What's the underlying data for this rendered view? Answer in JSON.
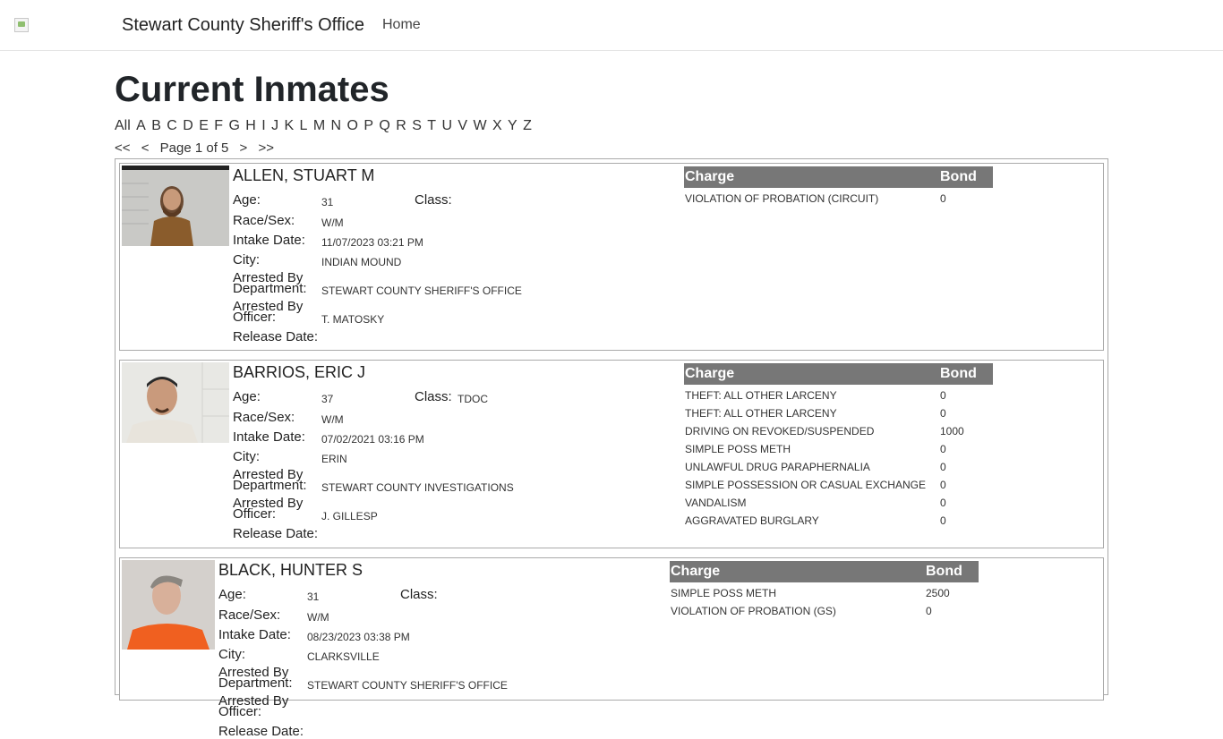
{
  "nav": {
    "brand": "Stewart County Sheriff's Office",
    "home": "Home"
  },
  "page_title": "Current Inmates",
  "letters": [
    "All",
    "A",
    "B",
    "C",
    "D",
    "E",
    "F",
    "G",
    "H",
    "I",
    "J",
    "K",
    "L",
    "M",
    "N",
    "O",
    "P",
    "Q",
    "R",
    "S",
    "T",
    "U",
    "V",
    "W",
    "X",
    "Y",
    "Z"
  ],
  "pager": {
    "first": "<<",
    "prev": "<",
    "label": "Page 1 of 5",
    "next": ">",
    "last": ">>"
  },
  "field_labels": {
    "age": "Age:",
    "class": "Class:",
    "race_sex": "Race/Sex:",
    "intake": "Intake Date:",
    "city": "City:",
    "dept_1": "Arrested By",
    "dept_2": "Department:",
    "officer_1": "Arrested By",
    "officer_2": "Officer:",
    "release": "Release Date:"
  },
  "charge_headers": {
    "charge": "Charge",
    "bond": "Bond"
  },
  "inmates": [
    {
      "name": "ALLEN, STUART M",
      "age": "31",
      "class": "",
      "race_sex": "W/M",
      "intake": "11/07/2023 03:21 PM",
      "city": "INDIAN MOUND",
      "department": "STEWART COUNTY SHERIFF'S OFFICE",
      "officer": "T. MATOSKY",
      "release": "",
      "charges": [
        {
          "charge": "VIOLATION OF PROBATION (CIRCUIT)",
          "bond": "0"
        }
      ]
    },
    {
      "name": "BARRIOS, ERIC J",
      "age": "37",
      "class": "TDOC",
      "race_sex": "W/M",
      "intake": "07/02/2021 03:16 PM",
      "city": "ERIN",
      "department": "STEWART COUNTY INVESTIGATIONS",
      "officer": "J. GILLESP",
      "release": "",
      "charges": [
        {
          "charge": "THEFT: ALL OTHER LARCENY",
          "bond": "0"
        },
        {
          "charge": "THEFT: ALL OTHER LARCENY",
          "bond": "0"
        },
        {
          "charge": "DRIVING ON REVOKED/SUSPENDED",
          "bond": "1000"
        },
        {
          "charge": "SIMPLE POSS METH",
          "bond": "0"
        },
        {
          "charge": "UNLAWFUL DRUG PARAPHERNALIA",
          "bond": "0"
        },
        {
          "charge": "SIMPLE POSSESSION OR CASUAL EXCHANGE",
          "bond": "0"
        },
        {
          "charge": "VANDALISM",
          "bond": "0"
        },
        {
          "charge": "AGGRAVATED BURGLARY",
          "bond": "0"
        }
      ]
    },
    {
      "name": "BLACK, HUNTER S",
      "age": "31",
      "class": "",
      "race_sex": "W/M",
      "intake": "08/23/2023 03:38 PM",
      "city": "CLARKSVILLE",
      "department": "STEWART COUNTY SHERIFF'S OFFICE",
      "officer": "",
      "release": "",
      "charges": [
        {
          "charge": "SIMPLE POSS METH",
          "bond": "2500"
        },
        {
          "charge": "VIOLATION OF PROBATION (GS)",
          "bond": "0"
        }
      ]
    }
  ],
  "colors": {
    "table_header": "#777777",
    "card_border": "#aaaaaa",
    "text": "#212529"
  }
}
